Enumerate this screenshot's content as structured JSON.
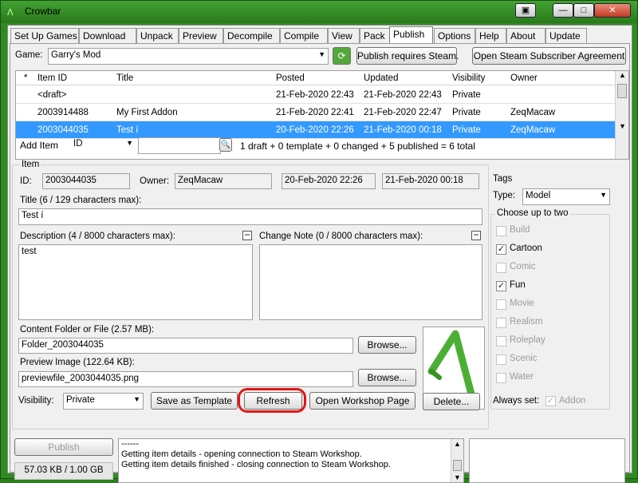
{
  "window": {
    "title": "Crowbar",
    "colors": {
      "frame": "#2f8a22",
      "selection": "#3399ff",
      "highlight": "#e01616"
    }
  },
  "tabs": [
    "Set Up Games",
    "Download",
    "Unpack",
    "Preview",
    "Decompile",
    "Compile",
    "View",
    "Pack",
    "Publish",
    "Options",
    "Help",
    "About",
    "Update"
  ],
  "publish": {
    "game_label": "Game:",
    "game_value": "Garry's Mod",
    "steam_required": "Publish requires Steam.",
    "agreement_button": "Open Steam Subscriber Agreement",
    "table": {
      "columns": [
        "*",
        "Item ID",
        "Title",
        "Posted",
        "Updated",
        "Visibility",
        "Owner"
      ],
      "rows": [
        {
          "star": "",
          "id": "<draft>",
          "title": "",
          "posted": "21-Feb-2020 22:43",
          "updated": "21-Feb-2020 22:43",
          "visibility": "Private",
          "owner": ""
        },
        {
          "star": "",
          "id": "2003914488",
          "title": "My First Addon",
          "posted": "21-Feb-2020 22:41",
          "updated": "21-Feb-2020 22:47",
          "visibility": "Private",
          "owner": "ZeqMacaw"
        },
        {
          "star": "",
          "id": "2003044035",
          "title": "Test í",
          "posted": "20-Feb-2020 22:26",
          "updated": "21-Feb-2020 00:18",
          "visibility": "Private",
          "owner": "ZeqMacaw"
        }
      ]
    },
    "add_item": "Add Item",
    "filter_field": "ID",
    "summary": "1 draft + 0 template + 0 changed + 5 published = 6 total",
    "item_group": "Item",
    "id_label": "ID:",
    "id_value": "2003044035",
    "owner_label": "Owner:",
    "owner_value": "ZeqMacaw",
    "posted_value": "20-Feb-2020 22:26",
    "updated_value": "21-Feb-2020 00:18",
    "title_label": "Title (6 / 129 characters max):",
    "title_value": "Test í",
    "description_label": "Description (4 / 8000 characters max):",
    "description_value": "test",
    "change_note_label": "Change Note (0 / 8000 characters max):",
    "content_label": "Content Folder or File (2.57 MB):",
    "content_value": "Folder_2003044035",
    "preview_label": "Preview Image (122.64 KB):",
    "preview_value": "previewfile_2003044035.png",
    "browse_label": "Browse...",
    "visibility_label": "Visibility:",
    "visibility_value": "Private",
    "save_template": "Save as Template",
    "refresh": "Refresh",
    "open_workshop": "Open Workshop Page",
    "delete": "Delete...",
    "tags_label": "Tags",
    "type_label": "Type:",
    "type_value": "Model",
    "choose_label": "Choose up to two",
    "tags": [
      {
        "label": "Build",
        "checked": false,
        "enabled": false
      },
      {
        "label": "Cartoon",
        "checked": true,
        "enabled": true
      },
      {
        "label": "Comic",
        "checked": false,
        "enabled": false
      },
      {
        "label": "Fun",
        "checked": true,
        "enabled": true
      },
      {
        "label": "Movie",
        "checked": false,
        "enabled": false
      },
      {
        "label": "Realism",
        "checked": false,
        "enabled": false
      },
      {
        "label": "Roleplay",
        "checked": false,
        "enabled": false
      },
      {
        "label": "Scenic",
        "checked": false,
        "enabled": false
      },
      {
        "label": "Water",
        "checked": false,
        "enabled": false
      }
    ],
    "always_set_label": "Always set:",
    "addon_label": "Addon",
    "publish_button": "Publish",
    "storage": "57.03 KB / 1.00 GB",
    "log": [
      "------",
      "Getting item details - opening connection to Steam Workshop.",
      "Getting item details finished - closing connection to Steam Workshop."
    ]
  }
}
